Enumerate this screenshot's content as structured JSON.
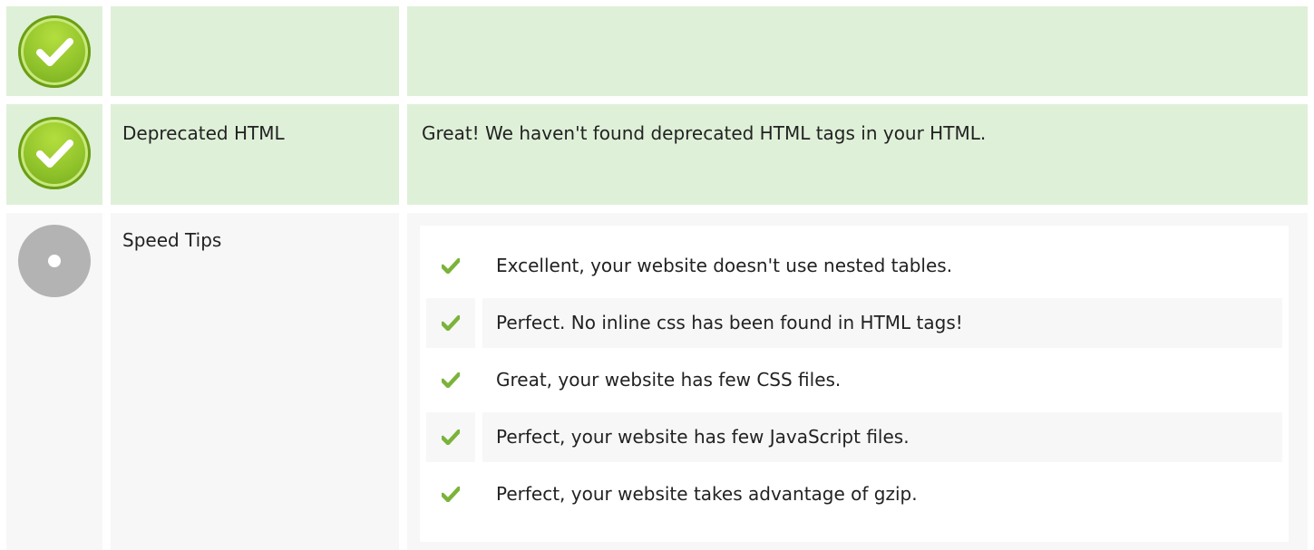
{
  "rows": [
    {
      "status": "ok",
      "label": "",
      "description": ""
    },
    {
      "status": "ok",
      "label": "Deprecated HTML",
      "description": "Great! We haven't found deprecated HTML tags in your HTML."
    },
    {
      "status": "neutral",
      "label": "Speed Tips",
      "tips": [
        "Excellent, your website doesn't use nested tables.",
        "Perfect. No inline css has been found in HTML tags!",
        "Great, your website has few CSS files.",
        "Perfect, your website has few JavaScript files.",
        "Perfect, your website takes advantage of gzip."
      ]
    }
  ],
  "icons": {
    "ok": "check-circle-icon",
    "neutral": "neutral-circle-icon",
    "tip": "checkmark-icon"
  },
  "colors": {
    "ok_row_bg": "#dff0d8",
    "neutral_row_bg": "#f7f7f7",
    "ok_icon": "#8fc22a",
    "neutral_icon": "#b3b3b3",
    "tip_check": "#7bb33a"
  }
}
